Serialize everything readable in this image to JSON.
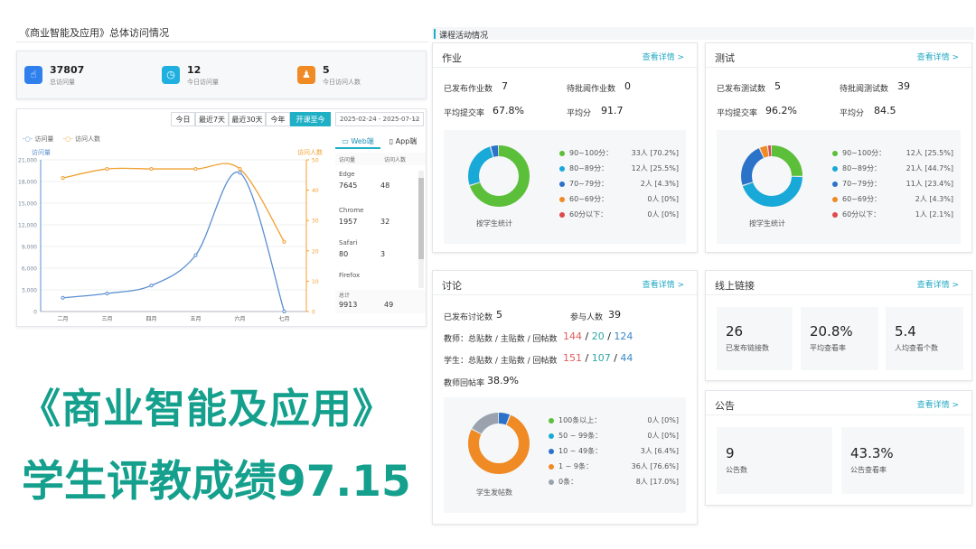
{
  "visit": {
    "title": "《商业智能及应用》总体访问情况",
    "stats": [
      {
        "value": "37807",
        "label": "总访问量",
        "icon": "click-icon",
        "color": "#2f80ed"
      },
      {
        "value": "12",
        "label": "今日访问量",
        "icon": "clock-icon",
        "color": "#1fb0e0"
      },
      {
        "value": "5",
        "label": "今日访问人数",
        "icon": "users-icon",
        "color": "#f08a24"
      }
    ],
    "filters": [
      "今日",
      "最近7天",
      "最近30天",
      "今年",
      "开课至今"
    ],
    "active_filter": "开课至今",
    "date_range": "2025-02-24 - 2025-07-12",
    "legend": [
      "访问量",
      "访问人数"
    ],
    "left_axis_label": "访问量",
    "right_axis_label": "访问人数",
    "tabs": [
      "Web端",
      "App端"
    ],
    "table_headers": [
      "访问量",
      "访问人数"
    ],
    "browsers": [
      {
        "name": "Edge",
        "visits": "7645",
        "people": "48"
      },
      {
        "name": "Chrome",
        "visits": "1957",
        "people": "32"
      },
      {
        "name": "Safari",
        "visits": "80",
        "people": "3"
      },
      {
        "name": "Firefox",
        "visits": "",
        "people": ""
      }
    ],
    "total_label": "总计",
    "total_visits": "9913",
    "total_people": "49"
  },
  "chart_data": {
    "type": "line",
    "categories": [
      "二月",
      "三月",
      "四月",
      "五月",
      "六月",
      "七月"
    ],
    "series": [
      {
        "name": "访问量",
        "axis": "left",
        "color": "#5b8fd0",
        "values": [
          1900,
          2500,
          3600,
          7800,
          19200,
          0
        ]
      },
      {
        "name": "访问人数",
        "axis": "right",
        "color": "#f0a030",
        "values": [
          44,
          47,
          47,
          47,
          47,
          23
        ]
      }
    ],
    "left_ticks": [
      "0",
      "3,000",
      "6,000",
      "9,000",
      "12,000",
      "15,000",
      "18,000",
      "21,000"
    ],
    "right_ticks": [
      "0",
      "10",
      "20",
      "30",
      "40",
      "50"
    ],
    "ylim_left": [
      0,
      21000
    ],
    "ylim_right": [
      0,
      50
    ],
    "legend": "top-left"
  },
  "activity_title": "课程活动情况",
  "homework": {
    "title": "作业",
    "more": "查看详情 >",
    "published_label": "已发布作业数",
    "published": "7",
    "pending_label": "待批阅作业数",
    "pending": "0",
    "rate_label": "平均提交率",
    "rate": "67.8%",
    "avg_label": "平均分",
    "avg": "91.7",
    "donut_label": "按学生统计",
    "legend": [
      {
        "label": "90~100分：",
        "value": "33人 [70.2%]",
        "color": "#5cbf3a",
        "pct": 70.2
      },
      {
        "label": "80~89分：",
        "value": "12人 [25.5%]",
        "color": "#19a9d8",
        "pct": 25.5
      },
      {
        "label": "70~79分：",
        "value": "2人 [4.3%]",
        "color": "#2b72c9",
        "pct": 4.3
      },
      {
        "label": "60~69分：",
        "value": "0人 [0%]",
        "color": "#f08a24",
        "pct": 0
      },
      {
        "label": "60分以下：",
        "value": "0人 [0%]",
        "color": "#e04a4a",
        "pct": 0
      }
    ]
  },
  "test": {
    "title": "测试",
    "more": "查看详情 >",
    "published_label": "已发布测试数",
    "published": "5",
    "pending_label": "待批阅测试数",
    "pending": "39",
    "rate_label": "平均提交率",
    "rate": "96.2%",
    "avg_label": "平均分",
    "avg": "84.5",
    "donut_label": "按学生统计",
    "legend": [
      {
        "label": "90~100分：",
        "value": "12人 [25.5%]",
        "color": "#5cbf3a",
        "pct": 25.5
      },
      {
        "label": "80~89分：",
        "value": "21人 [44.7%]",
        "color": "#19a9d8",
        "pct": 44.7
      },
      {
        "label": "70~79分：",
        "value": "11人 [23.4%]",
        "color": "#2b72c9",
        "pct": 23.4
      },
      {
        "label": "60~69分：",
        "value": "2人 [4.3%]",
        "color": "#f08a24",
        "pct": 4.3
      },
      {
        "label": "60分以下：",
        "value": "1人 [2.1%]",
        "color": "#e04a4a",
        "pct": 2.1
      }
    ]
  },
  "discussion": {
    "title": "讨论",
    "more": "查看详情 >",
    "published_label": "已发布讨论数",
    "published": "5",
    "participants_label": "参与人数",
    "participants": "39",
    "teacher_label": "教师：总贴数 / 主贴数 / 回帖数",
    "teacher_vals": [
      "144",
      "20",
      "124"
    ],
    "student_label": "学生：总贴数 / 主贴数 / 回帖数",
    "student_vals": [
      "151",
      "107",
      "44"
    ],
    "reply_rate_label": "教师回帖率",
    "reply_rate": "38.9%",
    "donut_label": "学生发帖数",
    "legend": [
      {
        "label": "100条以上：",
        "value": "0人 [0%]",
        "color": "#5cbf3a",
        "pct": 0
      },
      {
        "label": "50 ~ 99条：",
        "value": "0人 [0%]",
        "color": "#19a9d8",
        "pct": 0
      },
      {
        "label": "10 ~ 49条：",
        "value": "3人 [6.4%]",
        "color": "#2b72c9",
        "pct": 6.4
      },
      {
        "label": "1 ~ 9条：",
        "value": "36人 [76.6%]",
        "color": "#f08a24",
        "pct": 76.6
      },
      {
        "label": "0条：",
        "value": "8人 [17.0%]",
        "color": "#9aa3ad",
        "pct": 17.0
      }
    ]
  },
  "links": {
    "title": "线上链接",
    "more": "查看详情 >",
    "items": [
      {
        "value": "26",
        "label": "已发布链接数"
      },
      {
        "value": "20.8%",
        "label": "平均查看率"
      },
      {
        "value": "5.4",
        "label": "人均查看个数"
      }
    ]
  },
  "notice": {
    "title": "公告",
    "more": "查看详情 >",
    "items": [
      {
        "value": "9",
        "label": "公告数"
      },
      {
        "value": "43.3%",
        "label": "公告查看率"
      }
    ]
  },
  "overlay": {
    "line1": "《商业智能及应用》",
    "line2": "学生评教成绩97.15"
  }
}
